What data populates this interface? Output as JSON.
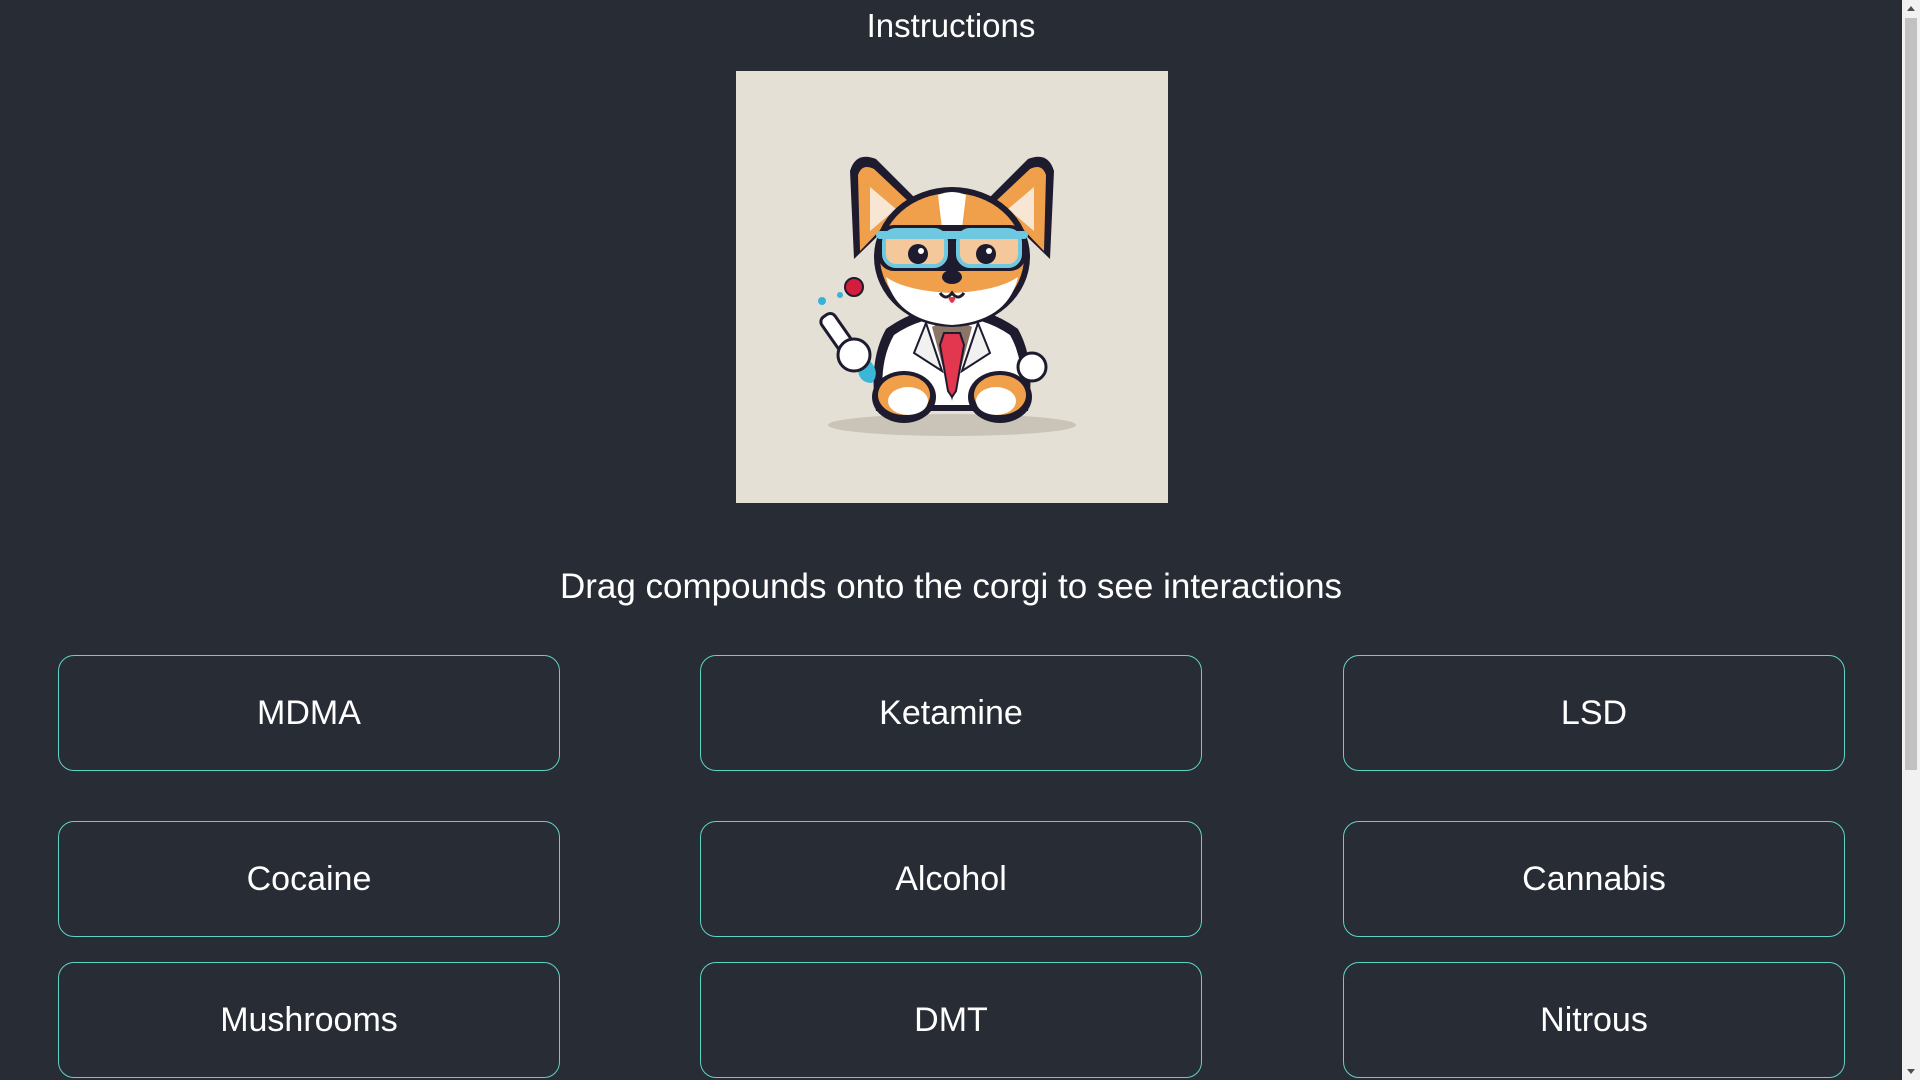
{
  "header": {
    "title": "Instructions"
  },
  "corgi": {
    "icon": "corgi-scientist-image"
  },
  "instruction_text": "Drag compounds onto the corgi to see interactions",
  "compounds": [
    {
      "label": "MDMA"
    },
    {
      "label": "Ketamine"
    },
    {
      "label": "LSD"
    },
    {
      "label": "Cocaine"
    },
    {
      "label": "Alcohol"
    },
    {
      "label": "Cannabis"
    },
    {
      "label": "Mushrooms"
    },
    {
      "label": "DMT"
    },
    {
      "label": "Nitrous"
    }
  ],
  "colors": {
    "background": "#282c34",
    "button_border": "#5fd3c6",
    "text": "#ffffff"
  }
}
